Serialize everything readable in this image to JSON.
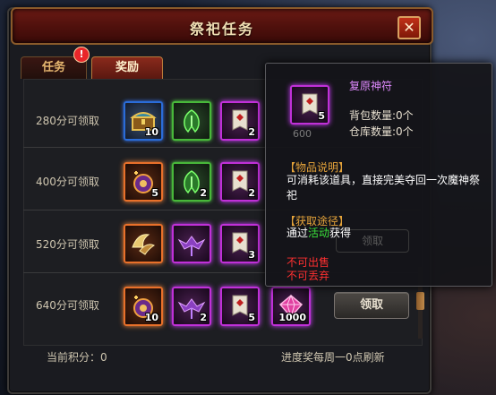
{
  "window": {
    "title": "祭祀任务",
    "close_label": "✕"
  },
  "tabs": [
    {
      "label": "任务",
      "active": false,
      "alert": "!"
    },
    {
      "label": "奖励",
      "active": true
    }
  ],
  "rows": [
    {
      "label": "280分可领取",
      "rewards": [
        {
          "icon": "treasure-chest-icon",
          "quality": "blue",
          "count": "10"
        },
        {
          "icon": "green-rune-icon",
          "quality": "green",
          "count": ""
        },
        {
          "icon": "scroll-banner-icon",
          "quality": "purple",
          "count": "2"
        }
      ]
    },
    {
      "label": "400分可领取",
      "rewards": [
        {
          "icon": "orange-crystal-icon",
          "quality": "orange",
          "count": "5"
        },
        {
          "icon": "green-rune-icon",
          "quality": "green",
          "count": "2"
        },
        {
          "icon": "scroll-banner-icon",
          "quality": "purple",
          "count": "2"
        }
      ]
    },
    {
      "label": "520分可领取",
      "rewards": [
        {
          "icon": "golden-wings-icon",
          "quality": "orange",
          "count": ""
        },
        {
          "icon": "purple-bat-icon",
          "quality": "purple",
          "count": ""
        },
        {
          "icon": "scroll-banner-icon",
          "quality": "purple",
          "count": "3"
        }
      ]
    },
    {
      "label": "640分可领取",
      "rewards": [
        {
          "icon": "orange-crystal-icon",
          "quality": "orange",
          "count": "10"
        },
        {
          "icon": "purple-bat-icon",
          "quality": "purple",
          "count": "2"
        },
        {
          "icon": "scroll-banner-icon",
          "quality": "purple",
          "count": "5"
        },
        {
          "icon": "pink-gem-icon",
          "quality": "purple",
          "count": "1000"
        }
      ],
      "button": "领取"
    }
  ],
  "footer": {
    "current_score": "当前积分：0",
    "refresh_note": "进度奖每周一0点刷新"
  },
  "tooltip": {
    "item_name": "复原神符",
    "item_count": "5",
    "bag_count": "背包数量:0个",
    "warehouse_count": "仓库数量:0个",
    "obscured_value": "600",
    "desc_head": "【物品说明】",
    "desc_body": "可消耗该道具，直接完美夺回一次魔神祭祀",
    "source_head": "【获取途径】",
    "source_pre": "通过",
    "source_highlight": "活动",
    "source_post": "获得",
    "no_sell": "不可出售",
    "no_discard": "不可丢弃",
    "ghost_button": "领取"
  },
  "colors": {
    "item_name": "#e08aff",
    "section_head": "#e6a43a",
    "warning": "#ff3030",
    "highlight": "#3ae03a"
  }
}
